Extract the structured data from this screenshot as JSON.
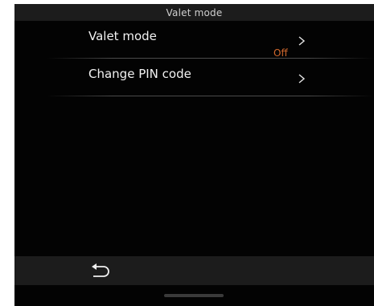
{
  "header": {
    "title": "Valet mode"
  },
  "menu": {
    "items": [
      {
        "label": "Valet mode",
        "value": "Off",
        "icon": "chevron-right-icon"
      },
      {
        "label": "Change PIN code",
        "value": "",
        "icon": "chevron-right-icon"
      }
    ]
  },
  "footer": {
    "back_icon": "back-arrow-icon"
  },
  "colors": {
    "background": "#030303",
    "bar": "#1c1c1c",
    "text": "#f2f2f2",
    "accent": "#d2692d"
  }
}
